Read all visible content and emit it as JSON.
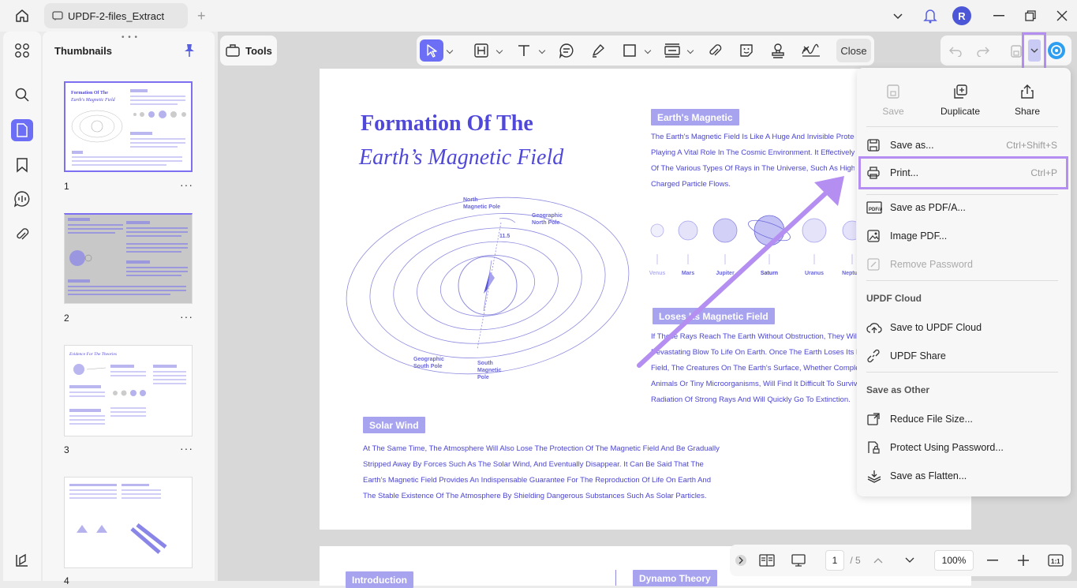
{
  "window": {
    "tab_title": "UPDF-2-files_Extract",
    "avatar_letter": "R"
  },
  "thumbnails": {
    "title": "Thumbnails",
    "pages": [
      "1",
      "2",
      "3",
      "4"
    ],
    "more": "···"
  },
  "toolbar": {
    "tools_label": "Tools",
    "close_label": "Close"
  },
  "page": {
    "title_line1": "Formation Of The",
    "title_line2": "Earth’s Magnetic Field",
    "section1_label": "Earth's Magnetic",
    "section1_text": [
      "The Earth's Magnetic Field Is Like A Huge And Invisible Protec",
      "Playing A Vital Role In The Cosmic Environment. It Effectively I",
      "Of The Various Types Of Rays in The Universe, Such As High-",
      "Charged Particle Flows."
    ],
    "planets": [
      "Venus",
      "Mars",
      "Jupiter",
      "Saturn",
      "Uranus",
      "Neptu"
    ],
    "diagram_labels": {
      "north_magnetic": "North\nMagnetic Pole",
      "geo_north": "Geographic\nNorth Pole",
      "geo_south": "Geographic\nSouth Pole",
      "south_magnetic": "South\nMagnetic\nPole",
      "angle": "11.5"
    },
    "section2_label": "Loses Its Magnetic Field",
    "section2_text": [
      "If These Rays Reach The Earth Without Obstruction, They Will",
      "Devastating Blow To Life On Earth. Once The Earth Loses Its M",
      "Field, The Creatures On The Earth's Surface, Whether Comple",
      "Animals Or Tiny Microorganisms, Will Find It Difficult To Surviv",
      "Radiation Of Strong Rays And Will Quickly Go To Extinction."
    ],
    "section3_label": "Solar Wind",
    "section3_text": [
      "At The Same Time, The Atmosphere Will Also Lose The Protection Of The Magnetic Field And Be Gradually",
      "Stripped Away By Forces Such As The Solar Wind, And Eventually Disappear. It Can Be Said That The",
      "Earth's Magnetic Field Provides An Indispensable Guarantee For The Reproduction Of Life On Earth And",
      "The Stable Existence Of The Atmosphere By Shielding Dangerous Substances Such As Solar Particles."
    ],
    "page2_labels": [
      "Introduction",
      "Dynamo Theory"
    ]
  },
  "menu": {
    "top": [
      {
        "label": "Save",
        "disabled": true
      },
      {
        "label": "Duplicate"
      },
      {
        "label": "Share"
      }
    ],
    "save_as": {
      "label": "Save as...",
      "shortcut": "Ctrl+Shift+S"
    },
    "print": {
      "label": "Print...",
      "shortcut": "Ctrl+P"
    },
    "save_pdfa": "Save as PDF/A...",
    "image_pdf": "Image PDF...",
    "remove_password": "Remove Password",
    "cloud_header": "UPDF Cloud",
    "save_cloud": "Save to UPDF Cloud",
    "updf_share": "UPDF Share",
    "other_header": "Save as Other",
    "reduce": "Reduce File Size...",
    "protect": "Protect Using Password...",
    "flatten": "Save as Flatten..."
  },
  "bottom": {
    "page_current": "1",
    "page_total": "/ 5",
    "zoom": "100%"
  },
  "colors": {
    "accent": "#6c6ff5",
    "highlight": "#b48ef0",
    "page_text": "#4b45d2"
  }
}
